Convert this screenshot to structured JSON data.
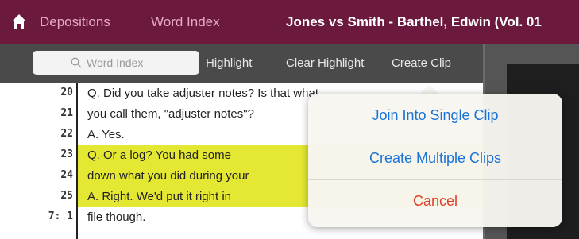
{
  "nav": {
    "home_icon": "home-icon",
    "depositions_label": "Depositions",
    "word_index_label": "Word Index",
    "case_title": "Jones vs Smith - Barthel, Edwin (Vol. 01"
  },
  "toolbar": {
    "search_placeholder": "Word Index",
    "search_icon": "search-icon",
    "highlight_label": "Highlight",
    "clear_highlight_label": "Clear Highlight",
    "create_clip_label": "Create Clip"
  },
  "transcript": {
    "lines": [
      {
        "no": "20",
        "text": "Q.  Did you take adjuster notes?  Is that what",
        "highlighted": false
      },
      {
        "no": "21",
        "text": "you call them, \"adjuster notes\"?",
        "highlighted": false
      },
      {
        "no": "22",
        "text": "A.  Yes.",
        "highlighted": false
      },
      {
        "no": "23",
        "text": "Q.  Or a log?  You had some",
        "highlighted": true
      },
      {
        "no": "24",
        "text": "down what you did during your",
        "highlighted": true
      },
      {
        "no": "25",
        "text": "A.  Right.  We'd put it right in",
        "highlighted": true
      },
      {
        "no": "7:  1",
        "text": "file though.",
        "highlighted": false
      }
    ]
  },
  "popover": {
    "join_label": "Join Into Single Clip",
    "multiple_label": "Create Multiple Clips",
    "cancel_label": "Cancel"
  },
  "colors": {
    "nav_bg": "#6b1a3e",
    "toolbar_bg": "#4a4a4a",
    "highlight": "#e5e832",
    "link_blue": "#1a73d9",
    "cancel_red": "#e0402a"
  }
}
